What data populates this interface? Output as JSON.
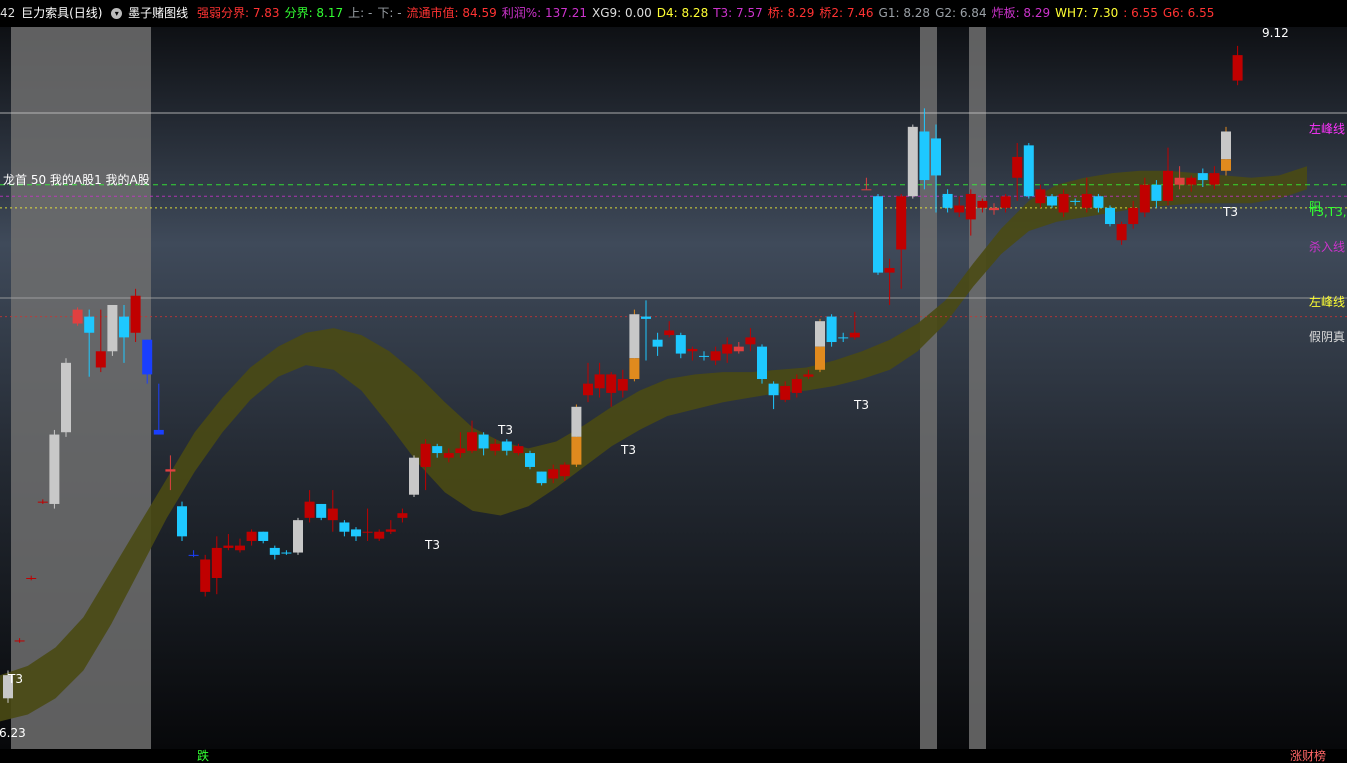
{
  "header": {
    "code_fragment": "42",
    "stock_name": "巨力索具(日线)",
    "indicator_name": "墨子赌图线",
    "fields": [
      {
        "label": "强弱分界: ",
        "value": "7.83",
        "color": "#ff3333"
      },
      {
        "label": "分界: ",
        "value": "8.17",
        "color": "#33ff33"
      },
      {
        "label": "上: ",
        "value": "-",
        "color": "#9aa0a6"
      },
      {
        "label": "下: ",
        "value": "-",
        "color": "#9aa0a6"
      },
      {
        "label": "流通市值: ",
        "value": "84.59",
        "color": "#ff3333"
      },
      {
        "label": "利润%: ",
        "value": "137.21",
        "color": "#cc33cc"
      },
      {
        "label": "XG9: ",
        "value": "0.00",
        "color": "#dddddd"
      },
      {
        "label": "D4: ",
        "value": "8.28",
        "color": "#ffff33"
      },
      {
        "label": "T3: ",
        "value": "7.57",
        "color": "#cc33cc"
      },
      {
        "label": "桥: ",
        "value": "8.29",
        "color": "#ff3333"
      },
      {
        "label": "桥2: ",
        "value": "7.46",
        "color": "#ff3333"
      },
      {
        "label": "G1: ",
        "value": "8.28",
        "color": "#9aa0a6"
      },
      {
        "label": "G2: ",
        "value": "6.84",
        "color": "#9aa0a6"
      },
      {
        "label": "炸板: ",
        "value": "8.29",
        "color": "#cc33cc"
      },
      {
        "label": "WH7: ",
        "value": "7.30",
        "color": "#ffff33"
      },
      {
        "label": ": ",
        "value": "6.55",
        "color": "#ff3333"
      },
      {
        "label": "G6: ",
        "value": "6.55",
        "color": "#ff3333"
      }
    ]
  },
  "overlay": {
    "sector_text": "龙首 50 我的A股1 我的A股",
    "price_high": "9.12",
    "price_low": "6.23",
    "right_labels": [
      {
        "text": "左峰线",
        "color": "#ff33ff"
      },
      {
        "text": "阳",
        "color": "#33ff33"
      },
      {
        "text": "T3,T3,",
        "color": "#33ff33"
      },
      {
        "text": "杀入线",
        "color": "#cc33cc"
      },
      {
        "text": "左峰线",
        "color": "#ffff33"
      },
      {
        "text": "假阴真",
        "color": "#dddddd"
      }
    ],
    "t3_marks": [
      "T3",
      "T3",
      "T3",
      "T3",
      "T3",
      "T3"
    ]
  },
  "footer": {
    "left_label": "跌",
    "right_label": "涨财榜"
  },
  "colors": {
    "up": "#c00000",
    "down": "#1ec8ff",
    "band": "#4a4a14",
    "ghost": "#c8c8c8",
    "shade": "#6e6e6e"
  },
  "chart_data": {
    "type": "candlestick",
    "y_range": [
      6.15,
      9.18
    ],
    "candles": [
      {
        "o": 6.3,
        "c": 6.4,
        "h": 6.42,
        "l": 6.28,
        "k": "g"
      },
      {
        "o": 6.55,
        "c": 6.55,
        "h": 6.56,
        "l": 6.54,
        "k": "u"
      },
      {
        "o": 6.82,
        "c": 6.82,
        "h": 6.83,
        "l": 6.81,
        "k": "u"
      },
      {
        "o": 7.15,
        "c": 7.15,
        "h": 7.16,
        "l": 7.14,
        "k": "u"
      },
      {
        "o": 7.14,
        "c": 7.44,
        "h": 7.46,
        "l": 7.12,
        "k": "g"
      },
      {
        "o": 7.45,
        "c": 7.75,
        "h": 7.77,
        "l": 7.43,
        "k": "g"
      },
      {
        "o": 7.92,
        "c": 7.98,
        "h": 7.99,
        "l": 7.91,
        "k": "n"
      },
      {
        "o": 7.95,
        "c": 7.88,
        "h": 7.98,
        "l": 7.69,
        "k": "d"
      },
      {
        "o": 7.73,
        "c": 7.8,
        "h": 7.98,
        "l": 7.71,
        "k": "u"
      },
      {
        "o": 7.8,
        "c": 8.0,
        "h": 8.0,
        "l": 7.78,
        "k": "g"
      },
      {
        "o": 7.86,
        "c": 7.95,
        "h": 8.0,
        "l": 7.75,
        "k": "d"
      },
      {
        "o": 7.88,
        "c": 8.04,
        "h": 8.07,
        "l": 7.84,
        "k": "u"
      },
      {
        "o": 7.85,
        "c": 7.7,
        "h": 7.85,
        "l": 7.66,
        "k": "b"
      },
      {
        "o": 7.46,
        "c": 7.44,
        "h": 7.66,
        "l": 7.44,
        "k": "b"
      },
      {
        "o": 7.28,
        "c": 7.29,
        "h": 7.35,
        "l": 7.2,
        "k": "n"
      },
      {
        "o": 7.13,
        "c": 7.0,
        "h": 7.15,
        "l": 6.98,
        "k": "d"
      },
      {
        "o": 6.92,
        "c": 6.92,
        "h": 6.94,
        "l": 6.91,
        "k": "b"
      },
      {
        "o": 6.76,
        "c": 6.9,
        "h": 6.92,
        "l": 6.74,
        "k": "u"
      },
      {
        "o": 6.82,
        "c": 6.95,
        "h": 7.0,
        "l": 6.75,
        "k": "u"
      },
      {
        "o": 6.95,
        "c": 6.96,
        "h": 7.01,
        "l": 6.94,
        "k": "u"
      },
      {
        "o": 6.94,
        "c": 6.96,
        "h": 6.99,
        "l": 6.93,
        "k": "u"
      },
      {
        "o": 6.98,
        "c": 7.02,
        "h": 7.03,
        "l": 6.96,
        "k": "u"
      },
      {
        "o": 7.02,
        "c": 6.98,
        "h": 7.02,
        "l": 6.97,
        "k": "d"
      },
      {
        "o": 6.95,
        "c": 6.92,
        "h": 6.96,
        "l": 6.9,
        "k": "d"
      },
      {
        "o": 6.93,
        "c": 6.93,
        "h": 6.94,
        "l": 6.92,
        "k": "d"
      },
      {
        "o": 6.93,
        "c": 7.07,
        "h": 7.08,
        "l": 6.92,
        "k": "g"
      },
      {
        "o": 7.08,
        "c": 7.15,
        "h": 7.2,
        "l": 7.06,
        "k": "u"
      },
      {
        "o": 7.14,
        "c": 7.08,
        "h": 7.14,
        "l": 7.07,
        "k": "d"
      },
      {
        "o": 7.12,
        "c": 7.07,
        "h": 7.2,
        "l": 7.02,
        "k": "u"
      },
      {
        "o": 7.06,
        "c": 7.02,
        "h": 7.07,
        "l": 7.0,
        "k": "d"
      },
      {
        "o": 7.03,
        "c": 7.0,
        "h": 7.04,
        "l": 6.98,
        "k": "d"
      },
      {
        "o": 7.02,
        "c": 7.02,
        "h": 7.12,
        "l": 6.98,
        "k": "u"
      },
      {
        "o": 6.99,
        "c": 7.02,
        "h": 7.03,
        "l": 6.98,
        "k": "u"
      },
      {
        "o": 7.02,
        "c": 7.03,
        "h": 7.07,
        "l": 7.01,
        "k": "u"
      },
      {
        "o": 7.08,
        "c": 7.1,
        "h": 7.12,
        "l": 7.06,
        "k": "u"
      },
      {
        "o": 7.18,
        "c": 7.34,
        "h": 7.35,
        "l": 7.17,
        "k": "g"
      },
      {
        "o": 7.3,
        "c": 7.4,
        "h": 7.42,
        "l": 7.2,
        "k": "u"
      },
      {
        "o": 7.36,
        "c": 7.39,
        "h": 7.4,
        "l": 7.34,
        "k": "d"
      },
      {
        "o": 7.34,
        "c": 7.36,
        "h": 7.38,
        "l": 7.32,
        "k": "u"
      },
      {
        "o": 7.36,
        "c": 7.38,
        "h": 7.45,
        "l": 7.34,
        "k": "u"
      },
      {
        "o": 7.37,
        "c": 7.45,
        "h": 7.5,
        "l": 7.36,
        "k": "u"
      },
      {
        "o": 7.44,
        "c": 7.38,
        "h": 7.45,
        "l": 7.35,
        "k": "d"
      },
      {
        "o": 7.37,
        "c": 7.4,
        "h": 7.42,
        "l": 7.35,
        "k": "u"
      },
      {
        "o": 7.41,
        "c": 7.37,
        "h": 7.42,
        "l": 7.35,
        "k": "d"
      },
      {
        "o": 7.36,
        "c": 7.39,
        "h": 7.4,
        "l": 7.35,
        "k": "u"
      },
      {
        "o": 7.36,
        "c": 7.3,
        "h": 7.37,
        "l": 7.29,
        "k": "d"
      },
      {
        "o": 7.28,
        "c": 7.23,
        "h": 7.28,
        "l": 7.22,
        "k": "d"
      },
      {
        "o": 7.25,
        "c": 7.29,
        "h": 7.31,
        "l": 7.23,
        "k": "u"
      },
      {
        "o": 7.26,
        "c": 7.31,
        "h": 7.32,
        "l": 7.24,
        "k": "u"
      },
      {
        "o": 7.31,
        "c": 7.56,
        "h": 7.57,
        "l": 7.3,
        "k": "o",
        "go": 7.43
      },
      {
        "o": 7.61,
        "c": 7.66,
        "h": 7.75,
        "l": 7.58,
        "k": "u"
      },
      {
        "o": 7.64,
        "c": 7.7,
        "h": 7.75,
        "l": 7.6,
        "k": "u"
      },
      {
        "o": 7.7,
        "c": 7.62,
        "h": 7.71,
        "l": 7.56,
        "k": "u"
      },
      {
        "o": 7.63,
        "c": 7.68,
        "h": 7.72,
        "l": 7.6,
        "k": "u"
      },
      {
        "o": 7.68,
        "c": 7.96,
        "h": 7.98,
        "l": 7.67,
        "k": "o",
        "go": 7.77
      },
      {
        "o": 7.95,
        "c": 7.94,
        "h": 8.02,
        "l": 7.76,
        "k": "d"
      },
      {
        "o": 7.85,
        "c": 7.82,
        "h": 7.88,
        "l": 7.78,
        "k": "d"
      },
      {
        "o": 7.87,
        "c": 7.89,
        "h": 7.93,
        "l": 7.86,
        "k": "u"
      },
      {
        "o": 7.87,
        "c": 7.79,
        "h": 7.88,
        "l": 7.77,
        "k": "d"
      },
      {
        "o": 7.81,
        "c": 7.8,
        "h": 7.82,
        "l": 7.76,
        "k": "u"
      },
      {
        "o": 7.78,
        "c": 7.78,
        "h": 7.8,
        "l": 7.76,
        "k": "d"
      },
      {
        "o": 7.8,
        "c": 7.76,
        "h": 7.82,
        "l": 7.74,
        "k": "u"
      },
      {
        "o": 7.79,
        "c": 7.83,
        "h": 7.86,
        "l": 7.75,
        "k": "u"
      },
      {
        "o": 7.8,
        "c": 7.82,
        "h": 7.84,
        "l": 7.79,
        "k": "n"
      },
      {
        "o": 7.83,
        "c": 7.86,
        "h": 7.9,
        "l": 7.8,
        "k": "u"
      },
      {
        "o": 7.82,
        "c": 7.68,
        "h": 7.83,
        "l": 7.66,
        "k": "d"
      },
      {
        "o": 7.66,
        "c": 7.61,
        "h": 7.67,
        "l": 7.55,
        "k": "d"
      },
      {
        "o": 7.59,
        "c": 7.65,
        "h": 7.67,
        "l": 7.58,
        "k": "u"
      },
      {
        "o": 7.62,
        "c": 7.68,
        "h": 7.7,
        "l": 7.6,
        "k": "u"
      },
      {
        "o": 7.69,
        "c": 7.7,
        "h": 7.72,
        "l": 7.68,
        "k": "u"
      },
      {
        "o": 7.72,
        "c": 7.93,
        "h": 7.94,
        "l": 7.71,
        "k": "o",
        "go": 7.82
      },
      {
        "o": 7.95,
        "c": 7.84,
        "h": 7.96,
        "l": 7.82,
        "k": "d"
      },
      {
        "o": 7.86,
        "c": 7.86,
        "h": 7.88,
        "l": 7.84,
        "k": "d"
      },
      {
        "o": 7.86,
        "c": 7.88,
        "h": 7.97,
        "l": 7.85,
        "k": "u"
      },
      {
        "o": 8.5,
        "c": 8.5,
        "h": 8.55,
        "l": 8.5,
        "k": "n"
      },
      {
        "o": 8.47,
        "c": 8.14,
        "h": 8.48,
        "l": 8.13,
        "k": "d"
      },
      {
        "o": 8.14,
        "c": 8.16,
        "h": 8.2,
        "l": 8.0,
        "k": "u"
      },
      {
        "o": 8.24,
        "c": 8.47,
        "h": 8.48,
        "l": 8.07,
        "k": "u"
      },
      {
        "o": 8.47,
        "c": 8.77,
        "h": 8.78,
        "l": 8.46,
        "k": "g"
      },
      {
        "o": 8.75,
        "c": 8.54,
        "h": 8.85,
        "l": 8.5,
        "k": "d"
      },
      {
        "o": 8.56,
        "c": 8.72,
        "h": 8.78,
        "l": 8.4,
        "k": "d"
      },
      {
        "o": 8.48,
        "c": 8.42,
        "h": 8.5,
        "l": 8.4,
        "k": "d"
      },
      {
        "o": 8.4,
        "c": 8.43,
        "h": 8.47,
        "l": 8.38,
        "k": "u"
      },
      {
        "o": 8.37,
        "c": 8.48,
        "h": 8.5,
        "l": 8.3,
        "k": "u"
      },
      {
        "o": 8.42,
        "c": 8.45,
        "h": 8.46,
        "l": 8.4,
        "k": "u"
      },
      {
        "o": 8.41,
        "c": 8.42,
        "h": 8.44,
        "l": 8.39,
        "k": "n"
      },
      {
        "o": 8.42,
        "c": 8.47,
        "h": 8.48,
        "l": 8.4,
        "k": "u"
      },
      {
        "o": 8.55,
        "c": 8.64,
        "h": 8.7,
        "l": 8.45,
        "k": "u"
      },
      {
        "o": 8.69,
        "c": 8.47,
        "h": 8.7,
        "l": 8.46,
        "k": "d"
      },
      {
        "o": 8.44,
        "c": 8.5,
        "h": 8.52,
        "l": 8.42,
        "k": "u"
      },
      {
        "o": 8.47,
        "c": 8.43,
        "h": 8.48,
        "l": 8.42,
        "k": "d"
      },
      {
        "o": 8.4,
        "c": 8.48,
        "h": 8.5,
        "l": 8.38,
        "k": "u"
      },
      {
        "o": 8.45,
        "c": 8.45,
        "h": 8.46,
        "l": 8.43,
        "k": "d"
      },
      {
        "o": 8.42,
        "c": 8.48,
        "h": 8.55,
        "l": 8.4,
        "k": "u"
      },
      {
        "o": 8.47,
        "c": 8.42,
        "h": 8.48,
        "l": 8.4,
        "k": "d"
      },
      {
        "o": 8.42,
        "c": 8.35,
        "h": 8.43,
        "l": 8.34,
        "k": "d"
      },
      {
        "o": 8.35,
        "c": 8.28,
        "h": 8.36,
        "l": 8.26,
        "k": "u"
      },
      {
        "o": 8.35,
        "c": 8.42,
        "h": 8.45,
        "l": 8.33,
        "k": "u"
      },
      {
        "o": 8.4,
        "c": 8.52,
        "h": 8.55,
        "l": 8.38,
        "k": "u"
      },
      {
        "o": 8.52,
        "c": 8.45,
        "h": 8.54,
        "l": 8.42,
        "k": "d"
      },
      {
        "o": 8.45,
        "c": 8.58,
        "h": 8.68,
        "l": 8.43,
        "k": "u"
      },
      {
        "o": 8.55,
        "c": 8.52,
        "h": 8.6,
        "l": 8.5,
        "k": "n"
      },
      {
        "o": 8.55,
        "c": 8.52,
        "h": 8.56,
        "l": 8.49,
        "k": "u"
      },
      {
        "o": 8.54,
        "c": 8.57,
        "h": 8.59,
        "l": 8.51,
        "k": "d"
      },
      {
        "o": 8.52,
        "c": 8.57,
        "h": 8.6,
        "l": 8.5,
        "k": "u"
      },
      {
        "o": 8.58,
        "c": 8.75,
        "h": 8.77,
        "l": 8.56,
        "k": "o",
        "go": 8.63
      },
      {
        "o": 8.97,
        "c": 9.08,
        "h": 9.12,
        "l": 8.95,
        "k": "u"
      }
    ],
    "band": {
      "upper": [
        6.4,
        6.44,
        6.52,
        6.65,
        6.85,
        7.05,
        7.25,
        7.45,
        7.6,
        7.73,
        7.82,
        7.88,
        7.9,
        7.87,
        7.8,
        7.7,
        7.58,
        7.47,
        7.41,
        7.38,
        7.41,
        7.48,
        7.56,
        7.63,
        7.68,
        7.7,
        7.71,
        7.71,
        7.72,
        7.73,
        7.76,
        7.8,
        7.85,
        7.92,
        8.02,
        8.18,
        8.33,
        8.45,
        8.52,
        8.55,
        8.57,
        8.58,
        8.58,
        8.57,
        8.56,
        8.55,
        8.56,
        8.6
      ],
      "lower": [
        6.2,
        6.23,
        6.3,
        6.42,
        6.62,
        6.85,
        7.08,
        7.28,
        7.45,
        7.59,
        7.69,
        7.74,
        7.72,
        7.63,
        7.48,
        7.32,
        7.19,
        7.11,
        7.09,
        7.13,
        7.21,
        7.3,
        7.39,
        7.46,
        7.52,
        7.55,
        7.58,
        7.6,
        7.62,
        7.63,
        7.65,
        7.68,
        7.72,
        7.8,
        7.92,
        8.08,
        8.22,
        8.32,
        8.36,
        8.38,
        8.4,
        8.42,
        8.43,
        8.44,
        8.44,
        8.44,
        8.46,
        8.5
      ]
    },
    "hlines": [
      {
        "y": 8.83,
        "color": "#cccccc",
        "dash": ""
      },
      {
        "y": 8.52,
        "color": "#33ff33",
        "dash": "5,4"
      },
      {
        "y": 8.47,
        "color": "#cc33cc",
        "dash": "3,3"
      },
      {
        "y": 8.42,
        "color": "#ffff33",
        "dash": "2,3"
      },
      {
        "y": 8.03,
        "color": "#aaaaaa",
        "dash": ""
      },
      {
        "y": 7.95,
        "color": "#cc3333",
        "dash": "2,3"
      }
    ]
  }
}
